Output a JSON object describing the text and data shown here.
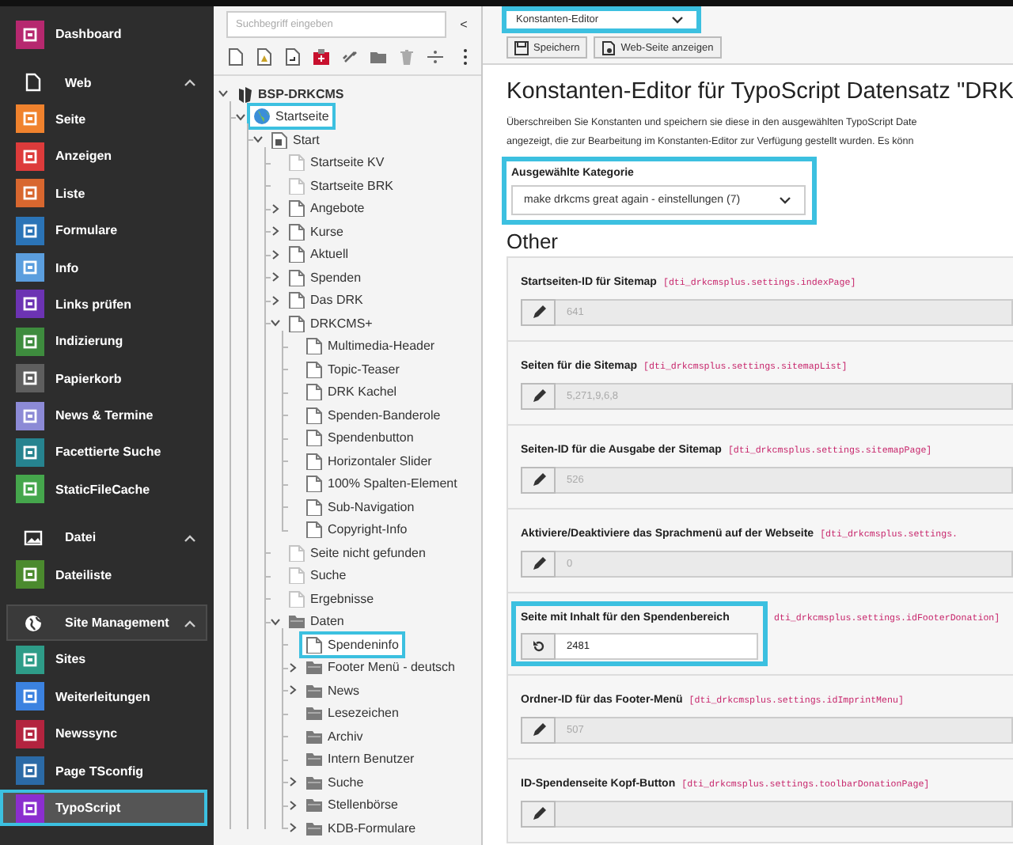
{
  "sidebar": {
    "groups": [
      {
        "items": [
          {
            "label": "Dashboard",
            "color": "#b6286f",
            "selected": false,
            "highlighted": false
          }
        ]
      },
      {
        "header": {
          "label": "Web",
          "expanded": true,
          "focused": false
        },
        "items": [
          {
            "label": "Seite",
            "color": "#f0822d",
            "selected": false,
            "highlighted": false
          },
          {
            "label": "Anzeigen",
            "color": "#dd3b3b",
            "selected": false,
            "highlighted": false
          },
          {
            "label": "Liste",
            "color": "#d8672f",
            "selected": false,
            "highlighted": false
          },
          {
            "label": "Formulare",
            "color": "#2b74b7",
            "selected": false,
            "highlighted": false
          },
          {
            "label": "Info",
            "color": "#5b9ede",
            "selected": false,
            "highlighted": false
          },
          {
            "label": "Links prüfen",
            "color": "#6c33b3",
            "selected": false,
            "highlighted": false
          },
          {
            "label": "Indizierung",
            "color": "#3e8c3e",
            "selected": false,
            "highlighted": false
          },
          {
            "label": "Papierkorb",
            "color": "#5e5e5e",
            "selected": false,
            "highlighted": false
          },
          {
            "label": "News & Termine",
            "color": "#8c8ad6",
            "selected": false,
            "highlighted": false
          },
          {
            "label": "Facettierte Suche",
            "color": "#26838f",
            "selected": false,
            "highlighted": false
          },
          {
            "label": "StaticFileCache",
            "color": "#45a64c",
            "selected": false,
            "highlighted": false
          }
        ]
      },
      {
        "header": {
          "label": "Datei",
          "expanded": true,
          "focused": false
        },
        "items": [
          {
            "label": "Dateiliste",
            "color": "#4b8a2e",
            "selected": false,
            "highlighted": false
          }
        ]
      },
      {
        "header": {
          "label": "Site Management",
          "expanded": true,
          "focused": true
        },
        "items": [
          {
            "label": "Sites",
            "color": "#2e9c88",
            "selected": false,
            "highlighted": false
          },
          {
            "label": "Weiterleitungen",
            "color": "#3b82e0",
            "selected": false,
            "highlighted": false
          },
          {
            "label": "Newssync",
            "color": "#b3243f",
            "selected": false,
            "highlighted": false
          },
          {
            "label": "Page TSconfig",
            "color": "#2b6aa6",
            "selected": false,
            "highlighted": false
          },
          {
            "label": "TypoScript",
            "color": "#8b2ecf",
            "selected": true,
            "highlighted": true
          }
        ]
      }
    ]
  },
  "page_tree": {
    "search": {
      "placeholder": "Suchbegriff eingeben"
    },
    "collapse_button": "<",
    "nodes": [
      {
        "label": "BSP-DRKCMS",
        "kind": "root",
        "expanded": true,
        "highlighted": false,
        "children": [
          {
            "label": "Startseite",
            "kind": "site",
            "expanded": true,
            "highlighted": true,
            "children": [
              {
                "label": "Start",
                "kind": "mount",
                "expanded": true,
                "highlighted": false,
                "children": [
                  {
                    "label": "Startseite KV",
                    "kind": "page-hidden",
                    "highlighted": false
                  },
                  {
                    "label": "Startseite BRK",
                    "kind": "page-hidden",
                    "highlighted": false
                  },
                  {
                    "label": "Angebote",
                    "kind": "page",
                    "expanded": false,
                    "highlighted": false
                  },
                  {
                    "label": "Kurse",
                    "kind": "page",
                    "expanded": false,
                    "highlighted": false
                  },
                  {
                    "label": "Aktuell",
                    "kind": "page",
                    "expanded": false,
                    "highlighted": false
                  },
                  {
                    "label": "Spenden",
                    "kind": "page",
                    "expanded": false,
                    "highlighted": false
                  },
                  {
                    "label": "Das DRK",
                    "kind": "page",
                    "expanded": false,
                    "highlighted": false
                  },
                  {
                    "label": "DRKCMS+",
                    "kind": "page",
                    "expanded": true,
                    "highlighted": false,
                    "children": [
                      {
                        "label": "Multimedia-Header",
                        "kind": "page",
                        "highlighted": false
                      },
                      {
                        "label": "Topic-Teaser",
                        "kind": "page",
                        "highlighted": false
                      },
                      {
                        "label": "DRK Kachel",
                        "kind": "page",
                        "highlighted": false
                      },
                      {
                        "label": "Spenden-Banderole",
                        "kind": "page",
                        "highlighted": false
                      },
                      {
                        "label": "Spendenbutton",
                        "kind": "page",
                        "highlighted": false
                      },
                      {
                        "label": "Horizontaler Slider",
                        "kind": "page",
                        "highlighted": false
                      },
                      {
                        "label": "100% Spalten-Element",
                        "kind": "page",
                        "highlighted": false
                      },
                      {
                        "label": "Sub-Navigation",
                        "kind": "page",
                        "highlighted": false
                      },
                      {
                        "label": "Copyright-Info",
                        "kind": "page",
                        "highlighted": false
                      }
                    ]
                  },
                  {
                    "label": "Seite nicht gefunden",
                    "kind": "page-hidden",
                    "highlighted": false
                  },
                  {
                    "label": "Suche",
                    "kind": "page-hidden",
                    "highlighted": false
                  },
                  {
                    "label": "Ergebnisse",
                    "kind": "page-hidden",
                    "highlighted": false
                  },
                  {
                    "label": "Daten",
                    "kind": "folder",
                    "expanded": true,
                    "highlighted": false,
                    "children": [
                      {
                        "label": "Spendeninfo",
                        "kind": "page",
                        "highlighted": true
                      },
                      {
                        "label": "Footer Menü - deutsch",
                        "kind": "folder",
                        "expanded": false,
                        "highlighted": false
                      },
                      {
                        "label": "News",
                        "kind": "folder",
                        "expanded": false,
                        "highlighted": false
                      },
                      {
                        "label": "Lesezeichen",
                        "kind": "folder",
                        "highlighted": false
                      },
                      {
                        "label": "Archiv",
                        "kind": "folder",
                        "highlighted": false
                      },
                      {
                        "label": "Intern Benutzer",
                        "kind": "folder",
                        "highlighted": false
                      },
                      {
                        "label": "Suche",
                        "kind": "folder",
                        "expanded": false,
                        "highlighted": false
                      },
                      {
                        "label": "Stellenbörse",
                        "kind": "folder",
                        "expanded": false,
                        "highlighted": false
                      },
                      {
                        "label": "KDB-Formulare",
                        "kind": "folder",
                        "expanded": false,
                        "highlighted": false
                      }
                    ]
                  }
                ]
              }
            ]
          }
        ]
      }
    ]
  },
  "content": {
    "view_select": {
      "value": "Konstanten-Editor",
      "highlighted": true
    },
    "buttons": [
      {
        "label": "Speichern",
        "kind": "save"
      },
      {
        "label": "Web-Seite anzeigen",
        "kind": "view"
      }
    ],
    "heading": "Konstanten-Editor für TypoScript Datensatz \"DRK",
    "description_lines": [
      "Überschreiben Sie Konstanten und speichern sie diese in den ausgewählten TypoScript Date",
      "angezeigt, die zur Bearbeitung im Konstanten-Editor zur Verfügung gestellt wurden. Es könn"
    ],
    "category": {
      "label": "Ausgewählte Kategorie",
      "value": "make drkcms great again - einstellungen (7)",
      "highlighted": true
    },
    "section_title": "Other",
    "constants": [
      {
        "label": "Startseiten-ID für Sitemap",
        "key": "[dti_drkcmsplus.settings.indexPage]",
        "placeholder": "641",
        "editing": false,
        "highlighted": false
      },
      {
        "label": "Seiten für die Sitemap",
        "key": "[dti_drkcmsplus.settings.sitemapList]",
        "placeholder": "5,271,9,6,8",
        "editing": false,
        "highlighted": false
      },
      {
        "label": "Seiten-ID für die Ausgabe der Sitemap",
        "key": "[dti_drkcmsplus.settings.sitemapPage]",
        "placeholder": "526",
        "editing": false,
        "highlighted": false
      },
      {
        "label": "Aktiviere/Deaktiviere das Sprachmenü auf der Webseite",
        "key": "[dti_drkcmsplus.settings.",
        "placeholder": "0",
        "editing": false,
        "highlighted": false
      },
      {
        "label": "Seite mit Inhalt für den Spendenbereich",
        "key": "dti_drkcmsplus.settings.idFooterDonation]",
        "value": "2481",
        "editing": true,
        "highlighted": true
      },
      {
        "label": "Ordner-ID für das Footer-Menü",
        "key": "[dti_drkcmsplus.settings.idImprintMenu]",
        "placeholder": "507",
        "editing": false,
        "highlighted": false
      },
      {
        "label": "ID-Spendenseite Kopf-Button",
        "key": "[dti_drkcmsplus.settings.toolbarDonationPage]",
        "editing": false,
        "highlighted": false
      }
    ]
  }
}
